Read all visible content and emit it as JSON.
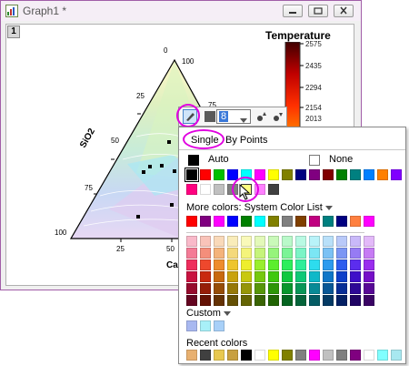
{
  "window": {
    "title": "Graph1 *",
    "layer_number": "1"
  },
  "plot": {
    "axis_titles": {
      "left": "SiO2",
      "bottom": "CaO"
    },
    "left_ticks": [
      "100",
      "75",
      "50",
      "25"
    ],
    "bottom_ticks": [
      "25",
      "50"
    ],
    "right_ticks": [
      "100",
      "75"
    ],
    "apex_tick": "0"
  },
  "legend": {
    "title": "Temperature",
    "values": [
      "2575",
      "2435",
      "2294",
      "2154",
      "2013"
    ]
  },
  "mini_toolbar": {
    "size_value": "8"
  },
  "color_popup": {
    "tabs": [
      "Single",
      "By Points"
    ],
    "active_tab": "Single",
    "auto_label": "Auto",
    "none_label": "None",
    "basic_colors": [
      "#000000",
      "#ff0000",
      "#00c000",
      "#0000ff",
      "#00ffff",
      "#ff00ff",
      "#ffff00",
      "#808000",
      "#000080",
      "#800080",
      "#800000",
      "#008000",
      "#008080",
      "#0080ff",
      "#ff8000",
      "#8000ff",
      "#ff0080",
      "#ffffff",
      "#c0c0c0",
      "#808080",
      "#ffff80",
      "#ff80ff",
      "#404040"
    ],
    "selected_color_index": 20,
    "more_colors_label": "More colors: System Color List",
    "system_row": [
      "#ff0000",
      "#800080",
      "#ff00ff",
      "#0000ff",
      "#008000",
      "#00ffff",
      "#808000",
      "#808080",
      "#804000",
      "#c00080",
      "#008080",
      "#000080",
      "#ff8040",
      "#ff00ff"
    ],
    "palette": [
      [
        "#f9b9c9",
        "#f9c3b9",
        "#f9d9b9",
        "#f9ecb9",
        "#f9f9b9",
        "#e3f9b9",
        "#c9f9b9",
        "#b9f9c9",
        "#b9f9e3",
        "#b9f3f9",
        "#b9e0f9",
        "#b9c9f9",
        "#c9b9f9",
        "#e3b9f9"
      ],
      [
        "#f47b96",
        "#f48e7b",
        "#f4b37b",
        "#f4d97b",
        "#f4f47b",
        "#c6f47b",
        "#96f47b",
        "#7bf496",
        "#7bf4c6",
        "#7be6f4",
        "#7bc1f4",
        "#7b96f4",
        "#967bf4",
        "#c67bf4"
      ],
      [
        "#ee2d5c",
        "#ee482d",
        "#ee8c2d",
        "#eec52d",
        "#eeee2d",
        "#9aee2d",
        "#5cee2d",
        "#2dee5c",
        "#2dee9a",
        "#2ddcee",
        "#2d9aee",
        "#2d5cee",
        "#5c2dee",
        "#9a2dee"
      ],
      [
        "#c8123f",
        "#c8290f",
        "#c8690f",
        "#c8a20f",
        "#c8c80f",
        "#76c80f",
        "#3fc80f",
        "#0fc83f",
        "#0fc876",
        "#0fb8c8",
        "#0f76c8",
        "#0f3fc8",
        "#3f0fc8",
        "#760fc8"
      ],
      [
        "#960b2d",
        "#961d08",
        "#964d08",
        "#967808",
        "#969608",
        "#579608",
        "#2d9608",
        "#08962d",
        "#089657",
        "#088a96",
        "#085796",
        "#082d96",
        "#2d0896",
        "#570896"
      ],
      [
        "#640520",
        "#641204",
        "#643204",
        "#645004",
        "#646404",
        "#3a6404",
        "#206404",
        "#046420",
        "#04643a",
        "#045c64",
        "#043a64",
        "#042064",
        "#200464",
        "#3a0464"
      ]
    ],
    "custom_label": "Custom",
    "custom_colors": [
      "#a8b8f0",
      "#a8f0f8",
      "#a8d0f8"
    ],
    "recent_label": "Recent colors",
    "recent_colors": [
      "#e8b070",
      "#404040",
      "#e8c850",
      "#c8a040",
      "#000000",
      "#ffffff",
      "#ffff00",
      "#808000",
      "#808080",
      "#ff00ff",
      "#c0c0c0",
      "#808080",
      "#800080",
      "#ffffff",
      "#80ffff",
      "#a8e8f0"
    ]
  }
}
